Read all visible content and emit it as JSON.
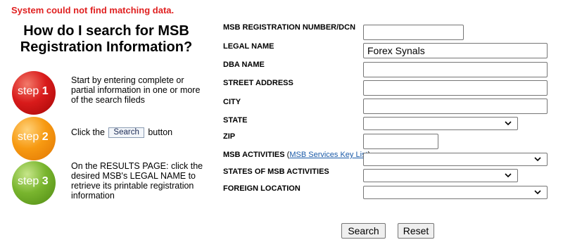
{
  "error_message": "System could not find matching data.",
  "help": {
    "title_line1": "How do I search for MSB",
    "title_line2": "Registration Information?",
    "steps": [
      {
        "word": "step",
        "num": "1",
        "text": "Start by entering complete or partial information in one or more of the search fileds"
      },
      {
        "word": "step",
        "num": "2",
        "text_before": "Click the",
        "button": "Search",
        "text_after": "button"
      },
      {
        "word": "step",
        "num": "3",
        "text": "On the RESULTS PAGE: click the desired MSB's LEGAL NAME to retrieve its printable registration information"
      }
    ]
  },
  "form": {
    "msb_reg_label": "MSB REGISTRATION NUMBER/DCN",
    "msb_reg_value": "",
    "legal_name_label": "LEGAL NAME",
    "legal_name_value": "Forex Synals",
    "dba_label": "DBA NAME",
    "street_label": "STREET ADDRESS",
    "city_label": "CITY",
    "state_label": "STATE",
    "state_value": "",
    "zip_label": "ZIP",
    "activities_label": "MSB ACTIVITIES",
    "activities_paren_open": "(",
    "activities_link": "MSB Services Key List",
    "activities_paren_close": ")",
    "states_activities_label": "STATES OF MSB ACTIVITIES",
    "foreign_label": "FOREIGN LOCATION"
  },
  "buttons": {
    "search": "Search",
    "reset": "Reset"
  }
}
